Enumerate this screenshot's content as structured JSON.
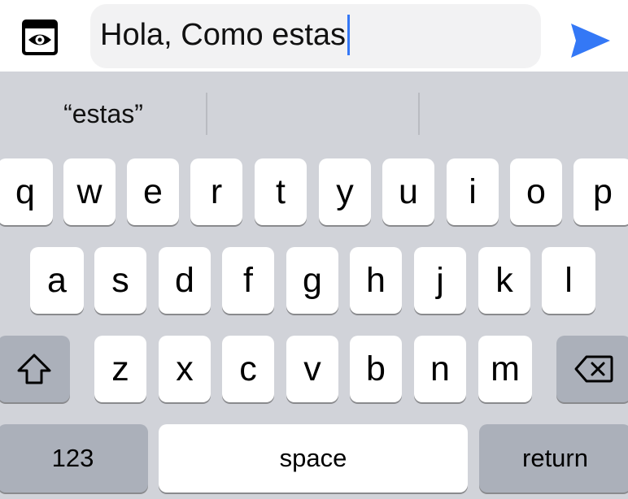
{
  "compose": {
    "text": "Hola, Como estas",
    "left_icon": "eye-icon",
    "send_icon": "send-arrow-icon",
    "accent_color": "#3478f6"
  },
  "suggestions": [
    "“estas”",
    "",
    ""
  ],
  "keyboard": {
    "row1": [
      "q",
      "w",
      "e",
      "r",
      "t",
      "y",
      "u",
      "i",
      "o",
      "p"
    ],
    "row2": [
      "a",
      "s",
      "d",
      "f",
      "g",
      "h",
      "j",
      "k",
      "l"
    ],
    "row3": [
      "z",
      "x",
      "c",
      "v",
      "b",
      "n",
      "m"
    ],
    "shift_icon": "shift-arrow-icon",
    "delete_icon": "backspace-icon",
    "numbers_label": "123",
    "space_label": "space",
    "return_label": "return"
  }
}
